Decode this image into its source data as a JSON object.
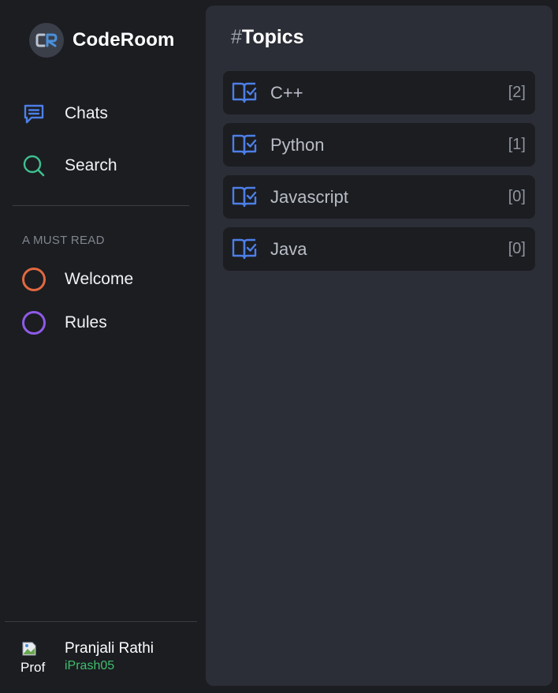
{
  "app": {
    "name": "CodeRoom",
    "logo_text": "CR"
  },
  "nav": {
    "items": [
      {
        "label": "Chats",
        "icon": "chat-icon",
        "color": "#4d7fe8"
      },
      {
        "label": "Search",
        "icon": "search-icon",
        "color": "#3fbf8f"
      }
    ]
  },
  "must_read": {
    "heading": "A MUST READ",
    "items": [
      {
        "label": "Welcome",
        "color": "#e0693f"
      },
      {
        "label": "Rules",
        "color": "#8f5ae8"
      }
    ]
  },
  "profile": {
    "avatar_alt": "Prof",
    "name": "Pranjali Rathi",
    "handle": "iPrash05"
  },
  "main": {
    "hash": "#",
    "title": "Topics",
    "topics": [
      {
        "name": "C++",
        "count": "[2]"
      },
      {
        "name": "Python",
        "count": "[1]"
      },
      {
        "name": "Javascript",
        "count": "[0]"
      },
      {
        "name": "Java",
        "count": "[0]"
      }
    ]
  },
  "colors": {
    "background": "#1b1d21",
    "panel": "#2b2e36",
    "accent_blue": "#4d7fe8",
    "handle_green": "#3fbf6e"
  }
}
